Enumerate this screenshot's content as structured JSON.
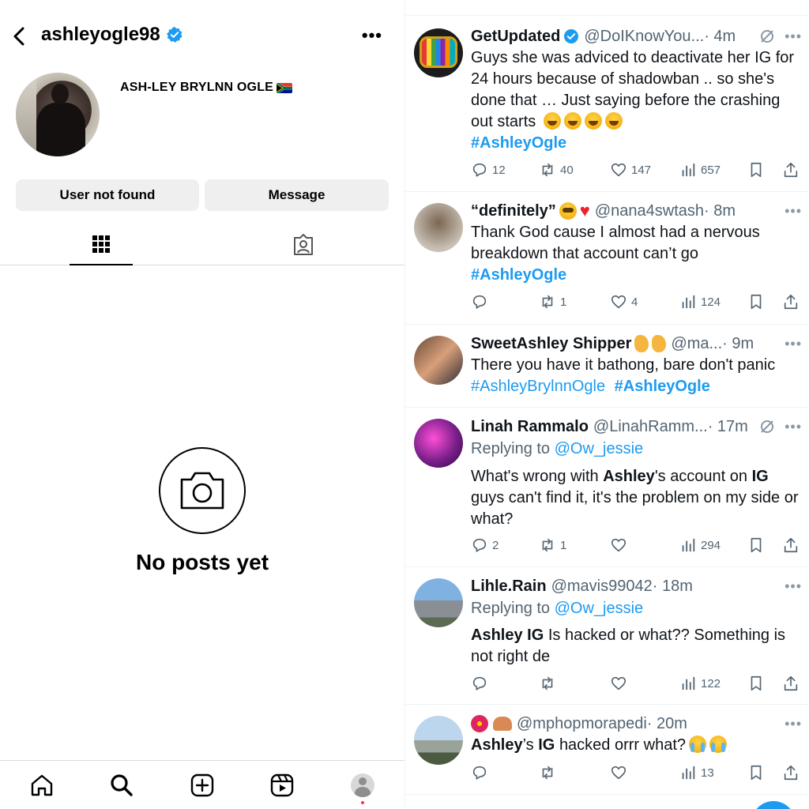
{
  "instagram": {
    "username": "ashleyogle98",
    "full_name": "ASH-LEY BRYLNN OGLE",
    "buttons": {
      "primary": "User not found",
      "secondary": "Message"
    },
    "empty_state": "No posts yet"
  },
  "twitter": {
    "tweets": [
      {
        "name": "GetUpdated",
        "handle": "@DoIKnowYou...",
        "time": "· 4m",
        "text": "Guys she was adviced to deactivate her IG for 24 hours  because of shadowban .. so she's done that … Just saying before the crashing out starts",
        "hashtag": "#AshleyOgle",
        "replies": "12",
        "reposts": "40",
        "likes": "147",
        "views": "657"
      },
      {
        "name": "“definitely”",
        "handle": "@nana4swtash",
        "time": "· 8m",
        "text": "Thank God cause I almost had a nervous breakdown that account can’t go",
        "hashtag": "#AshleyOgle",
        "replies": "",
        "reposts": "1",
        "likes": "4",
        "views": "124"
      },
      {
        "name": "SweetAshley Shipper",
        "handle": "@ma...",
        "time": "· 9m",
        "text": "There you have it bathong, bare don't panic",
        "hashtag1": "#AshleyBrylnnOgle",
        "hashtag2": "#AshleyOgle"
      },
      {
        "name": "Linah Rammalo",
        "handle": "@LinahRamm...",
        "time": "· 17m",
        "replying_prefix": "Replying to",
        "replying_to": "@Ow_jessie",
        "text_a": "What's wrong with",
        "bold_a": "Ashley",
        "text_b": "'s account on",
        "bold_b": "IG",
        "text_c": "guys can't find it, it's the problem on my side or what?",
        "replies": "2",
        "reposts": "1",
        "likes": "",
        "views": "294"
      },
      {
        "name": "Lihle.Rain",
        "handle": "@mavis99042",
        "time": "· 18m",
        "replying_prefix": "Replying to",
        "replying_to": "@Ow_jessie",
        "bold_a": "Ashley",
        "bold_b": "IG",
        "text_a": "Is hacked or what?? Something is not right de",
        "replies": "",
        "reposts": "",
        "likes": "",
        "views": "122"
      },
      {
        "name": "",
        "handle": "@mphopmorapedi",
        "time": "· 20m",
        "bold_a": "Ashley",
        "text_a": "’s",
        "bold_b": "IG",
        "text_b": "hacked orrr what?",
        "replies": "",
        "reposts": "",
        "likes": "",
        "views": "13"
      }
    ]
  },
  "colors": {
    "accent": "#1d9bf0",
    "muted": "#536471",
    "ig_button": "#efefef"
  }
}
